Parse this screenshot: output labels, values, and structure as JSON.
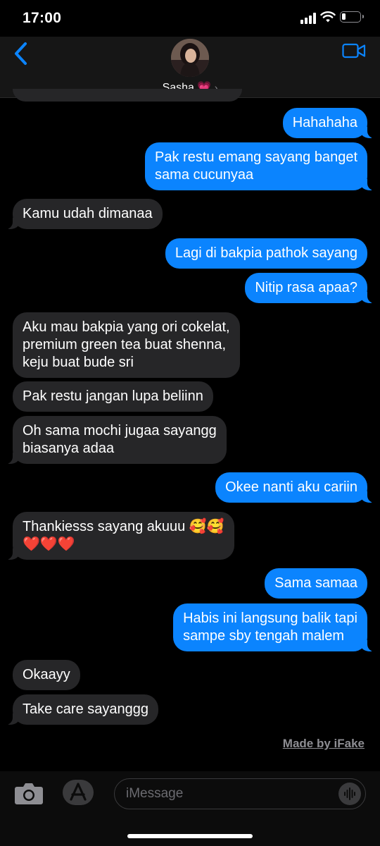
{
  "status_bar": {
    "time": "17:00"
  },
  "header": {
    "contact_name": "Sasha",
    "contact_emoji": "💗",
    "chevron": "›"
  },
  "messages": [
    {
      "from": "me",
      "text": "Hahahaha"
    },
    {
      "from": "me",
      "text": "Pak restu emang sayang banget\nsama cucunyaa"
    },
    {
      "from": "them",
      "text": "Kamu udah dimanaa"
    },
    {
      "from": "me",
      "text": "Lagi di bakpia pathok sayang"
    },
    {
      "from": "me",
      "text": "Nitip rasa apaa?"
    },
    {
      "from": "them",
      "text": "Aku mau bakpia yang ori cokelat,\npremium green tea buat shenna,\nkeju buat bude sri"
    },
    {
      "from": "them",
      "text": "Pak restu jangan lupa beliinn"
    },
    {
      "from": "them",
      "text": "Oh sama mochi jugaa sayangg\nbiasanya adaa"
    },
    {
      "from": "me",
      "text": "Okee nanti aku cariin"
    },
    {
      "from": "them",
      "text": "Thankiesss sayang akuuu 🥰🥰\n❤️❤️❤️"
    },
    {
      "from": "me",
      "text": "Sama samaa"
    },
    {
      "from": "me",
      "text": "Habis ini langsung balik tapi\nsampe sby tengah malem"
    },
    {
      "from": "them",
      "text": "Okaayy"
    },
    {
      "from": "them",
      "text": "Take care sayanggg"
    }
  ],
  "watermark": "Made by iFake",
  "composer": {
    "placeholder": "iMessage"
  },
  "icons": {
    "back": "chevron-left-icon",
    "video": "video-camera-icon",
    "camera": "camera-icon",
    "apps": "app-store-icon",
    "audio": "waveform-icon"
  },
  "colors": {
    "outgoing": "#0b84fe",
    "incoming": "#262628",
    "accent": "#0b84fe"
  }
}
